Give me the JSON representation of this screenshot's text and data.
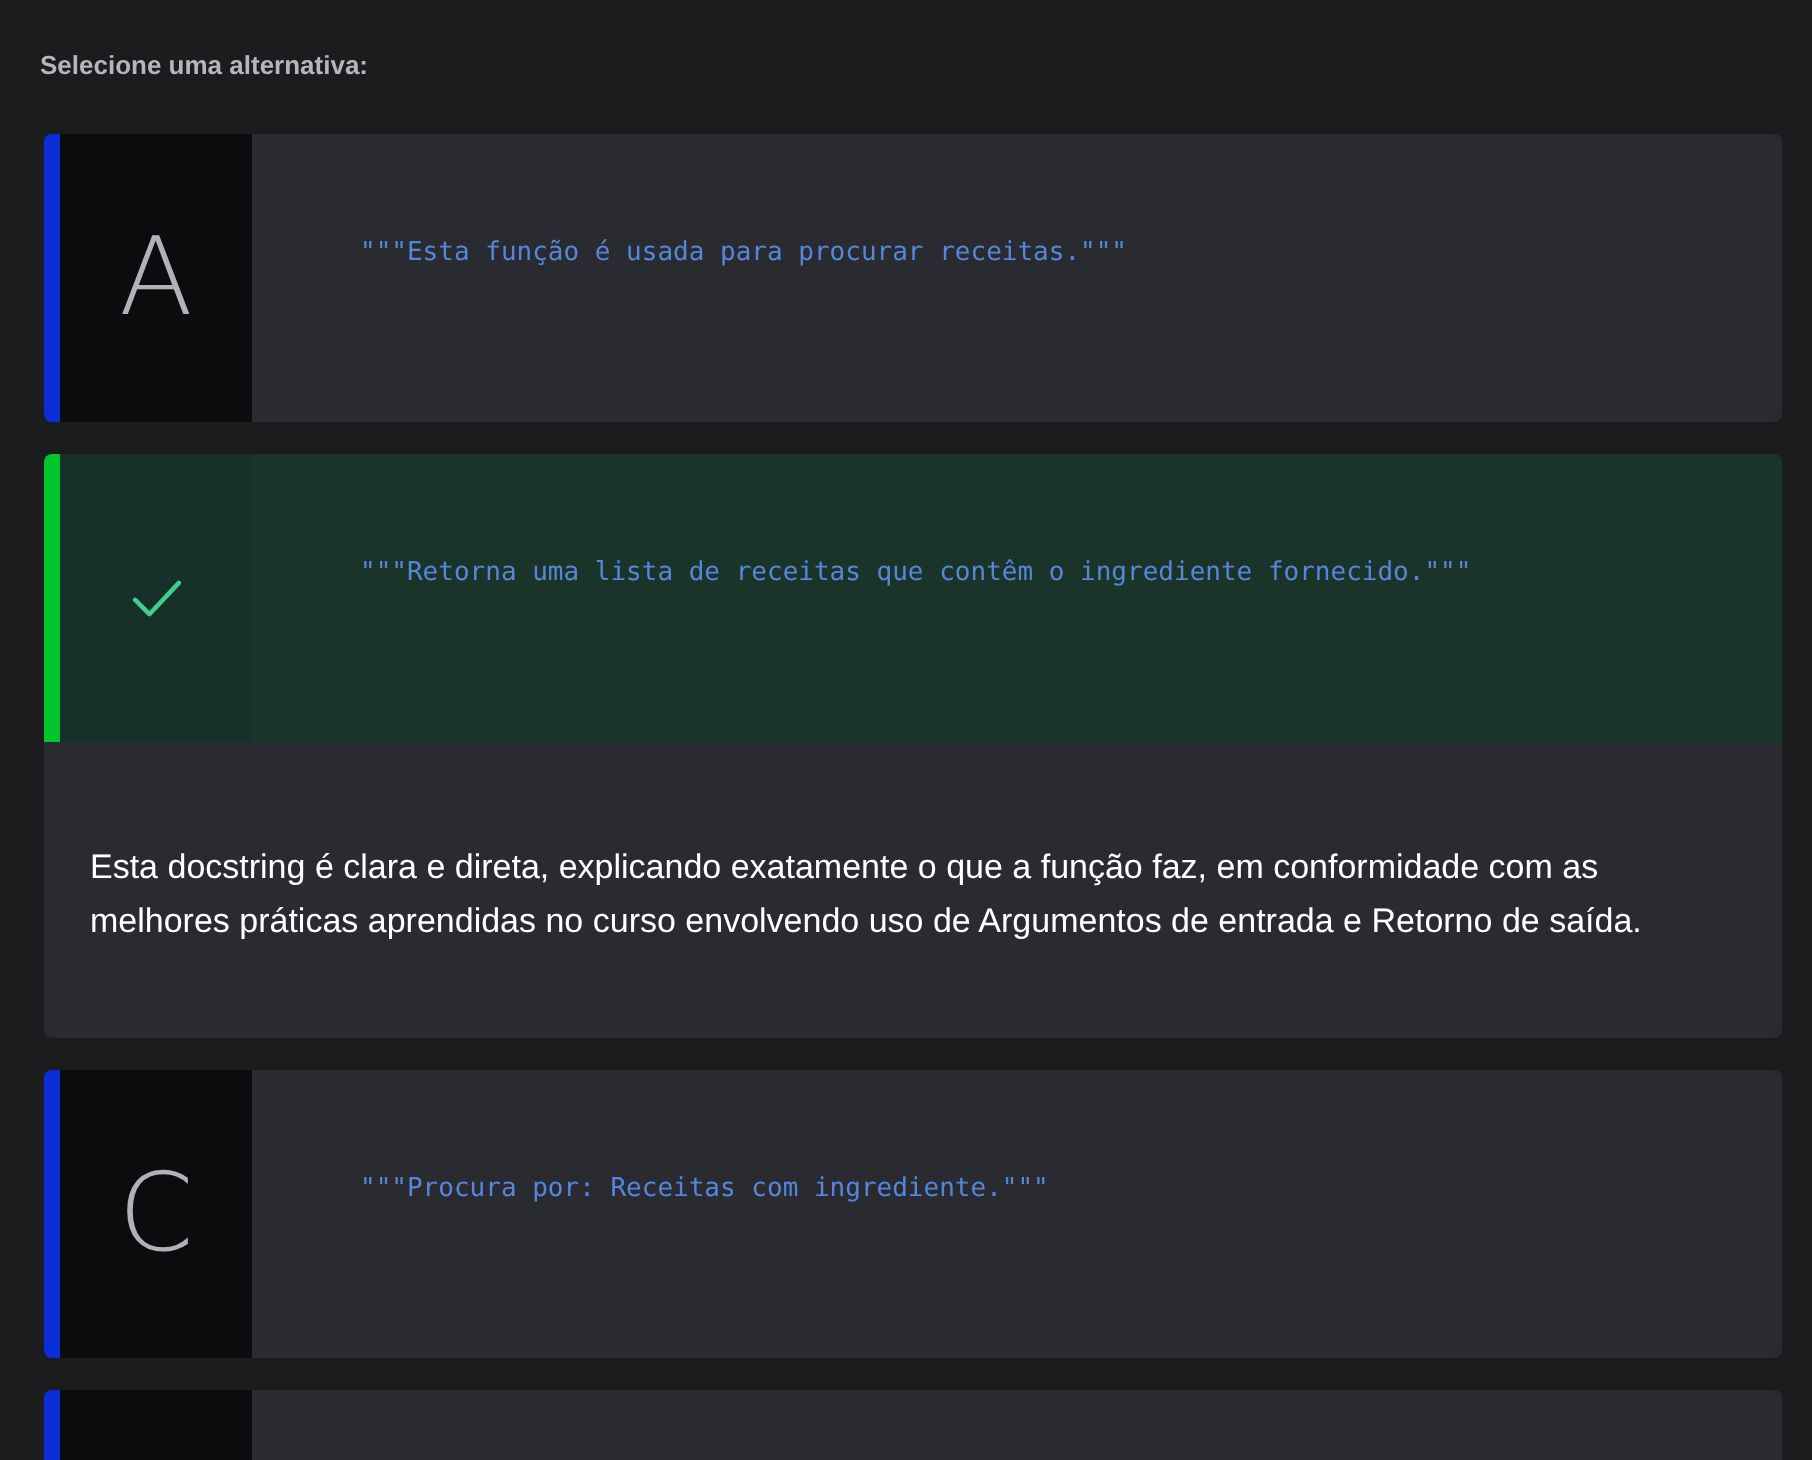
{
  "prompt": "Selecione uma alternativa:",
  "options": [
    {
      "letter": "A",
      "text": "\"\"\"Esta função é usada para procurar receitas.\"\"\"",
      "selected": false
    },
    {
      "text": "\"\"\"Retorna uma lista de receitas que contêm o ingrediente fornecido.\"\"\"",
      "selected": true,
      "feedback": "Esta docstring é clara e direta, explicando exatamente o que a função faz, em conformidade com as melhores práticas aprendidas no curso envolvendo uso de Argumentos de entrada e Retorno de saída."
    },
    {
      "letter": "C",
      "text": "\"\"\"Procura por: Receitas com ingrediente.\"\"\"",
      "selected": false
    },
    {
      "selected": false
    }
  ]
}
